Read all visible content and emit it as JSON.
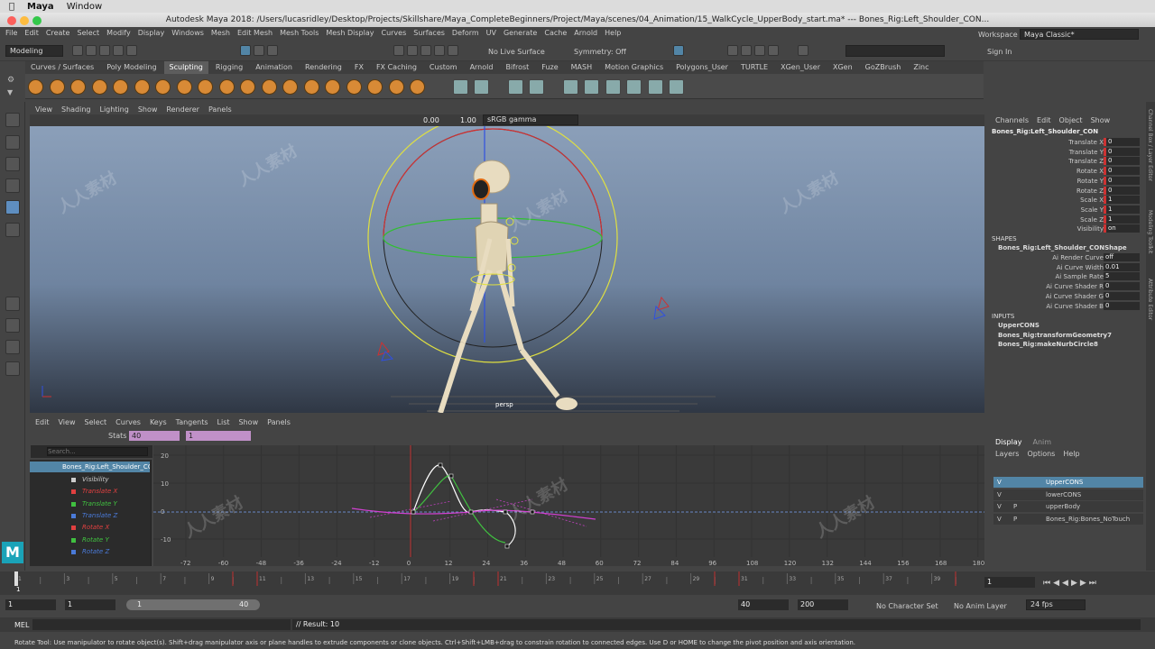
{
  "mac_menu": {
    "app": "Maya",
    "item": "Window"
  },
  "window_title": "Autodesk Maya 2018: /Users/lucasridley/Desktop/Projects/Skillshare/Maya_CompleteBeginners/Project/Maya/scenes/04_Animation/15_WalkCycle_UpperBody_start.ma*  ---  Bones_Rig:Left_Shoulder_CON...",
  "main_menu": [
    "File",
    "Edit",
    "Create",
    "Select",
    "Modify",
    "Display",
    "Windows",
    "Mesh",
    "Edit Mesh",
    "Mesh Tools",
    "Mesh Display",
    "Curves",
    "Surfaces",
    "Deform",
    "UV",
    "Generate",
    "Cache",
    "Arnold",
    "Help"
  ],
  "status_line": {
    "menu_set": "Modeling",
    "live_surface": "No Live Surface",
    "symmetry": "Symmetry: Off",
    "workspace_label": "Workspace :",
    "workspace": "Maya Classic*",
    "sign_in": "Sign In"
  },
  "shelf_tabs": [
    "Curves / Surfaces",
    "Poly Modeling",
    "Sculpting",
    "Rigging",
    "Animation",
    "Rendering",
    "FX",
    "FX Caching",
    "Custom",
    "Arnold",
    "Bifrost",
    "Fuze",
    "MASH",
    "Motion Graphics",
    "Polygons_User",
    "TURTLE",
    "XGen_User",
    "XGen",
    "GoZBrush",
    "Zinc"
  ],
  "active_shelf_tab": "Sculpting",
  "viewport": {
    "menu": [
      "View",
      "Shading",
      "Lighting",
      "Show",
      "Renderer",
      "Panels"
    ],
    "exposure": "0.00",
    "gamma": "1.00",
    "color_space": "sRGB gamma",
    "camera_label": "persp"
  },
  "graph_editor": {
    "menu": [
      "Edit",
      "View",
      "Select",
      "Curves",
      "Keys",
      "Tangents",
      "List",
      "Show",
      "Panels"
    ],
    "stats_label": "Stats",
    "stats_value1": "40",
    "stats_value2": "1",
    "search_placeholder": "Search...",
    "outliner": {
      "node": "Bones_Rig:Left_Shoulder_CON",
      "attrs": [
        {
          "label": "Visibility",
          "color": "#cccccc"
        },
        {
          "label": "Translate X",
          "color": "#e04040"
        },
        {
          "label": "Translate Y",
          "color": "#40c040"
        },
        {
          "label": "Translate Z",
          "color": "#4a7ad8"
        },
        {
          "label": "Rotate X",
          "color": "#e04040"
        },
        {
          "label": "Rotate Y",
          "color": "#40c040"
        },
        {
          "label": "Rotate Z",
          "color": "#4a7ad8"
        }
      ]
    },
    "y_labels": [
      "20",
      "10",
      "0",
      "-10"
    ],
    "x_labels": [
      "-72",
      "-60",
      "-48",
      "-36",
      "-24",
      "-12",
      "0",
      "12",
      "24",
      "36",
      "48",
      "60",
      "72",
      "84",
      "96",
      "108",
      "120",
      "132",
      "144",
      "156",
      "168",
      "180"
    ]
  },
  "channel_box": {
    "menu": [
      "Channels",
      "Edit",
      "Object",
      "Show"
    ],
    "object": "Bones_Rig:Left_Shoulder_CON",
    "channels": [
      {
        "label": "Translate X",
        "value": "0"
      },
      {
        "label": "Translate Y",
        "value": "0"
      },
      {
        "label": "Translate Z",
        "value": "0"
      },
      {
        "label": "Rotate X",
        "value": "0"
      },
      {
        "label": "Rotate Y",
        "value": "0"
      },
      {
        "label": "Rotate Z",
        "value": "0"
      },
      {
        "label": "Scale X",
        "value": "1"
      },
      {
        "label": "Scale Y",
        "value": "1"
      },
      {
        "label": "Scale Z",
        "value": "1"
      },
      {
        "label": "Visibility",
        "value": "on"
      }
    ],
    "shapes_header": "SHAPES",
    "shape_name": "Bones_Rig:Left_Shoulder_CONShape",
    "shape_attrs": [
      {
        "label": "Ai Render Curve",
        "value": "off"
      },
      {
        "label": "Ai Curve Width",
        "value": "0.01"
      },
      {
        "label": "Ai Sample Rate",
        "value": "5"
      },
      {
        "label": "Ai Curve Shader R",
        "value": "0"
      },
      {
        "label": "Ai Curve Shader G",
        "value": "0"
      },
      {
        "label": "Ai Curve Shader B",
        "value": "0"
      }
    ],
    "inputs_header": "INPUTS",
    "inputs": [
      "UpperCONS",
      "Bones_Rig:transformGeometry7",
      "Bones_Rig:makeNurbCircle8"
    ]
  },
  "layer_editor": {
    "tabs": [
      "Display",
      "Anim"
    ],
    "menu": [
      "Layers",
      "Options",
      "Help"
    ],
    "layers": [
      {
        "v": "V",
        "p": "",
        "name": "UpperCONS",
        "selected": true
      },
      {
        "v": "V",
        "p": "",
        "name": "lowerCONS",
        "selected": false
      },
      {
        "v": "V",
        "p": "P",
        "name": "upperBody",
        "selected": false
      },
      {
        "v": "V",
        "p": "P",
        "name": "Bones_Rig:Bones_NoTouch",
        "selected": false
      }
    ]
  },
  "side_tabs": [
    "Channel Box / Layer Editor",
    "Modeling Toolkit",
    "Attribute Editor"
  ],
  "time_slider": {
    "ticks": [
      "1",
      "3",
      "5",
      "7",
      "9",
      "11",
      "13",
      "15",
      "17",
      "19",
      "21",
      "23",
      "25",
      "27",
      "29",
      "31",
      "33",
      "35",
      "37",
      "39"
    ],
    "current_frame": "1",
    "frame_field": "1"
  },
  "range": {
    "start": "1",
    "start2": "1",
    "slider_start": "1",
    "slider_end": "40",
    "end": "40",
    "anim_end": "200",
    "character_set": "No Character Set",
    "anim_layer": "No Anim Layer",
    "fps": "24 fps"
  },
  "command_line": {
    "label": "MEL",
    "result": "// Result: 10"
  },
  "help_line": "Rotate Tool: Use manipulator to rotate object(s). Shift+drag manipulator axis or plane handles to extrude components or clone objects. Ctrl+Shift+LMB+drag to constrain rotation to connected edges. Use D or HOME to change the pivot position and axis orientation.",
  "watermark": "人人素材"
}
